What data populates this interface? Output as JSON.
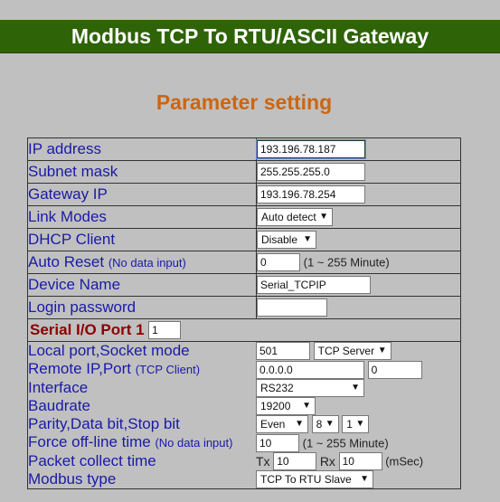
{
  "header": {
    "title": "Modbus TCP To RTU/ASCII Gateway"
  },
  "section_title": "Parameter setting",
  "network": {
    "ip_label": "IP address",
    "ip_value": "193.196.78.187",
    "subnet_label": "Subnet mask",
    "subnet_value": "255.255.255.0",
    "gateway_label": "Gateway IP",
    "gateway_value": "193.196.78.254",
    "link_label": "Link Modes",
    "link_value": "Auto detect",
    "dhcp_label": "DHCP Client",
    "dhcp_value": "Disable",
    "autoreset_label": "Auto Reset",
    "autoreset_note": "(No data input)",
    "autoreset_value": "0",
    "autoreset_range": "(1 ~ 255 Minute)",
    "device_label": "Device Name",
    "device_value": "Serial_TCPIP",
    "login_label": "Login password",
    "login_value": ""
  },
  "serial": {
    "title": "Serial I/O Port 1",
    "port_value": "1",
    "local_label": "Local port,Socket mode",
    "local_port": "501",
    "socket_mode": "TCP Server",
    "remote_label": "Remote IP,Port",
    "remote_note": "(TCP Client)",
    "remote_ip": "0.0.0.0",
    "remote_port": "0",
    "interface_label": "Interface",
    "interface_value": "RS232",
    "baud_label": "Baudrate",
    "baud_value": "19200",
    "pds_label": "Parity,Data bit,Stop bit",
    "parity": "Even",
    "data_bit": "8",
    "stop_bit": "1",
    "offline_label": "Force off-line time",
    "offline_note": "(No data input)",
    "offline_value": "10",
    "offline_range": "(1 ~ 255 Minute)",
    "packet_label": "Packet collect time",
    "tx_label": "Tx",
    "tx_value": "10",
    "rx_label": "Rx",
    "rx_value": "10",
    "packet_unit": "(mSec)",
    "modbus_label": "Modbus type",
    "modbus_value": "TCP To RTU Slave"
  },
  "icons": {
    "dropdown": "chevron-down-icon"
  },
  "colors": {
    "banner": "#2f6308",
    "title": "#cc6611",
    "label": "#1a1aa8",
    "serial_head": "#8b0000",
    "page_bg": "#c0c0c0"
  }
}
